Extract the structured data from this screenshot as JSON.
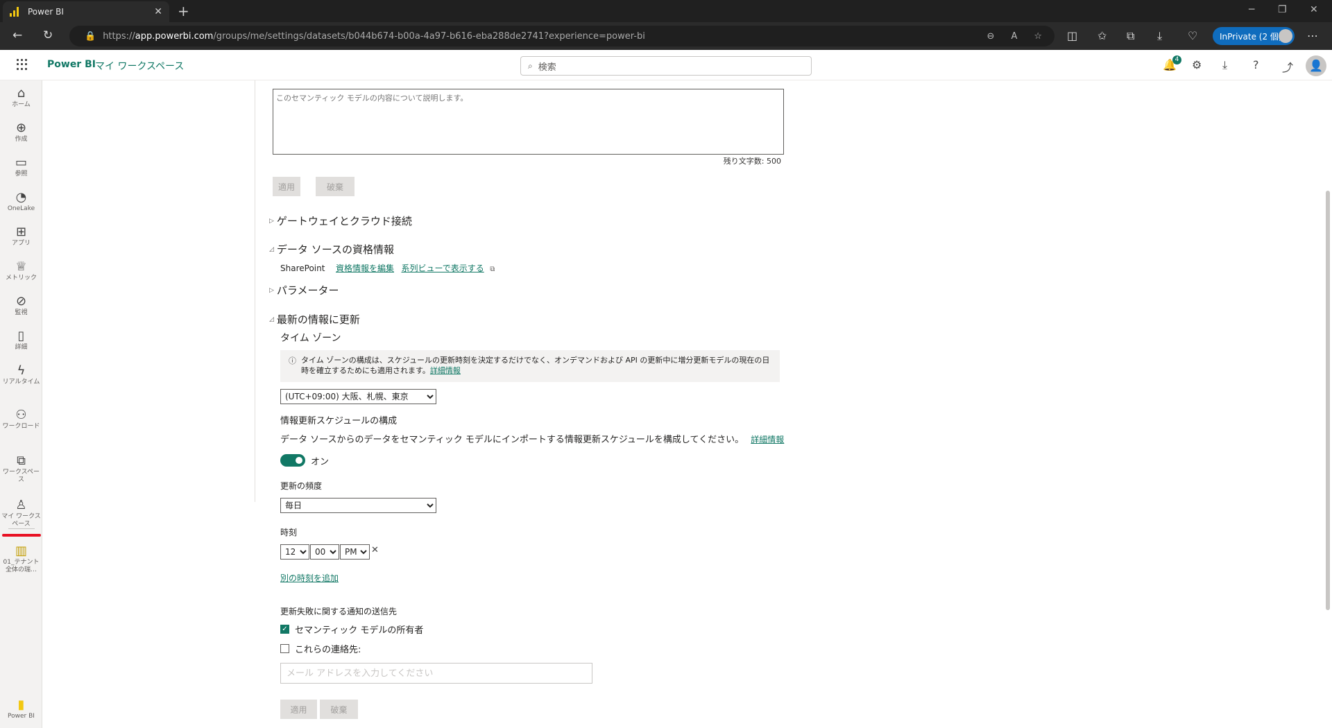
{
  "browser": {
    "tab_title": "Power BI",
    "tab_close": "✕",
    "new_tab": "+",
    "url_prefix": "https://",
    "url_host": "app.powerbi.com",
    "url_path": "/groups/me/settings/datasets/b044b674-b00a-4a97-b616-eba288de2741?experience=power-bi",
    "inprivate_label": "InPrivate (2 個)"
  },
  "header": {
    "brand": "Power BI",
    "breadcrumb": "マイ ワークスペース",
    "search_placeholder": "検索",
    "notification_count": "4"
  },
  "leftnav": {
    "items": [
      {
        "label": "ホーム",
        "icon": "home-icon"
      },
      {
        "label": "作成",
        "icon": "create-icon"
      },
      {
        "label": "参照",
        "icon": "browse-icon"
      },
      {
        "label": "OneLake",
        "icon": "onelake-icon"
      },
      {
        "label": "アプリ",
        "icon": "apps-icon"
      },
      {
        "label": "メトリック",
        "icon": "metrics-icon"
      },
      {
        "label": "監視",
        "icon": "monitor-icon"
      },
      {
        "label": "詳細",
        "icon": "learn-icon"
      },
      {
        "label": "リアルタイム",
        "icon": "realtime-icon"
      },
      {
        "label": "ワークロード",
        "icon": "workload-icon"
      },
      {
        "label": "ワークスペース",
        "icon": "workspaces-icon"
      },
      {
        "label": "マイ ワークスペース",
        "icon": "my-workspace-icon"
      },
      {
        "label": "01_テナント全体の瑞…",
        "icon": "report-icon"
      }
    ],
    "footer_label": "Power BI"
  },
  "description": {
    "placeholder": "このセマンティック モデルの内容について説明します。",
    "remaining": "残り文字数: 500",
    "apply": "適用",
    "discard": "破棄"
  },
  "sections": {
    "gateway": "ゲートウェイとクラウド接続",
    "credentials": "データ ソースの資格情報",
    "parameters": "パラメーター",
    "refresh": "最新の情報に更新"
  },
  "credentials": {
    "source": "SharePoint",
    "edit_link": "資格情報を編集",
    "lineage_link": "系列ビューで表示する"
  },
  "refresh": {
    "timezone_heading": "タイム ゾーン",
    "info_text": "タイム ゾーンの構成は、スケジュールの更新時刻を決定するだけでなく、オンデマンドおよび API の更新中に増分更新モデルの現在の日時を確立するためにも適用されます。",
    "info_link": "詳細情報",
    "timezone_value": "(UTC+09:00) 大阪、札幌、東京",
    "schedule_heading": "情報更新スケジュールの構成",
    "schedule_desc": "データ ソースからのデータをセマンティック モデルにインポートする情報更新スケジュールを構成してください。",
    "schedule_link": "詳細情報",
    "toggle_label": "オン",
    "frequency_label": "更新の頻度",
    "frequency_value": "毎日",
    "time_label": "時刻",
    "hour": "12",
    "minute": "00",
    "ampm": "PM",
    "remove_time": "✕",
    "add_time_link": "別の時刻を追加",
    "notify_heading": "更新失敗に関する通知の送信先",
    "owner_checkbox": "セマンティック モデルの所有者",
    "contacts_checkbox": "これらの連絡先:",
    "email_placeholder": "メール アドレスを入力してください",
    "apply": "適用",
    "discard": "破棄"
  }
}
